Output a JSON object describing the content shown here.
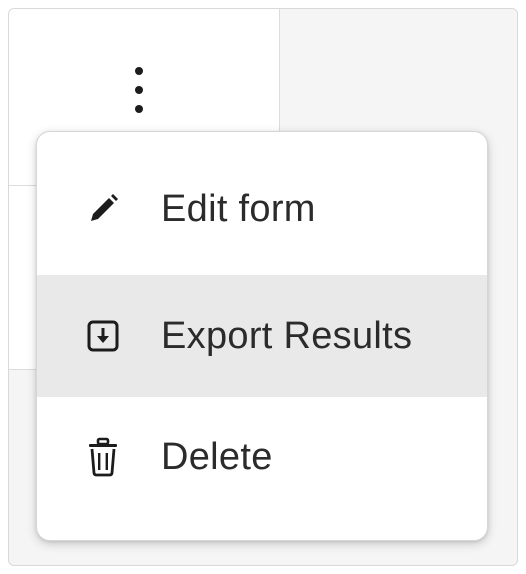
{
  "trigger": {
    "icon": "more-vertical-icon"
  },
  "menu": {
    "items": [
      {
        "label": "Edit form",
        "icon": "pencil-icon"
      },
      {
        "label": "Export Results",
        "icon": "download-box-icon",
        "highlighted": true
      },
      {
        "label": "Delete",
        "icon": "trash-icon"
      }
    ]
  },
  "colors": {
    "highlight": "#e9e9e9",
    "text": "#2b2b2b",
    "icon": "#1c1c1c"
  }
}
